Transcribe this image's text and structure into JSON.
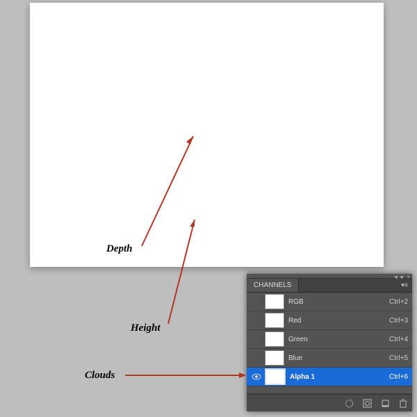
{
  "labels": {
    "depth": "Depth",
    "height": "Height",
    "clouds": "Clouds"
  },
  "panel": {
    "tab": "CHANNELS"
  },
  "channels": [
    {
      "name": "RGB",
      "shortcut": "Ctrl+2",
      "visible": false,
      "fill": "#ffffff",
      "selected": false
    },
    {
      "name": "Red",
      "shortcut": "Ctrl+3",
      "visible": false,
      "fill": "#ffffff",
      "selected": false
    },
    {
      "name": "Green",
      "shortcut": "Ctrl+4",
      "visible": false,
      "fill": "#ffffff",
      "selected": false
    },
    {
      "name": "Blue",
      "shortcut": "Ctrl+5",
      "visible": false,
      "fill": "#ffffff",
      "selected": false
    },
    {
      "name": "Alpha 1",
      "shortcut": "Ctrl+6",
      "visible": true,
      "fill": "clouds",
      "selected": true
    }
  ],
  "icons": {
    "collapse": "◄◄",
    "close": "×",
    "menu": "▾≡"
  }
}
